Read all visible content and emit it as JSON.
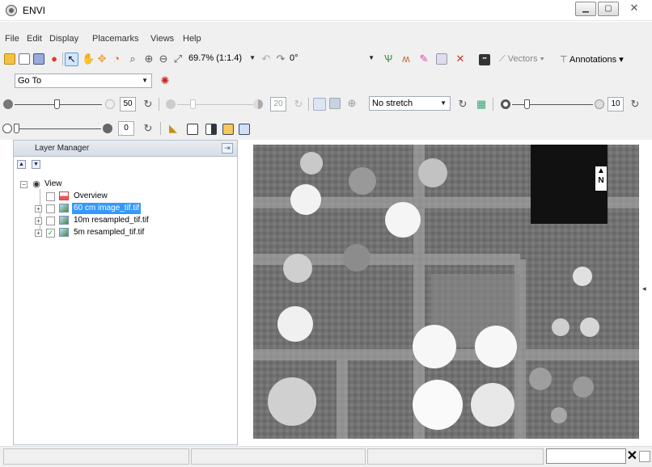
{
  "window": {
    "title": "ENVI"
  },
  "menubar": {
    "items": [
      "File",
      "Edit",
      "Display",
      "Placemarks",
      "Views",
      "Help"
    ]
  },
  "toolbar": {
    "zoom_value": "69.7% (1:1.4)",
    "rotation_value": "0°",
    "vectors_label": "Vectors",
    "annotations_label": "Annotations"
  },
  "goto": {
    "value": "Go To"
  },
  "adjustments": {
    "brightness_value": "50",
    "contrast_value": "20",
    "stretch_value": "No stretch",
    "sharpen_value": "10",
    "transparency_value": "0"
  },
  "layer_manager": {
    "title": "Layer Manager",
    "root_label": "View",
    "items": [
      {
        "label": "Overview",
        "checked": false,
        "selected": false
      },
      {
        "label": "60 cm image_tif.tif",
        "checked": false,
        "selected": true
      },
      {
        "label": "10m resampled_tif.tif",
        "checked": false,
        "selected": false
      },
      {
        "label": "5m resampled_tif.tif",
        "checked": true,
        "selected": false
      }
    ]
  },
  "map": {
    "north_label": "N"
  },
  "colors": {
    "selection": "#3399ff",
    "toolbar_bg": "#f0f0f0",
    "image_dark": "#111111",
    "image_light": "#f5f5f5"
  },
  "statusbar": {
    "close_glyph": "✕"
  }
}
